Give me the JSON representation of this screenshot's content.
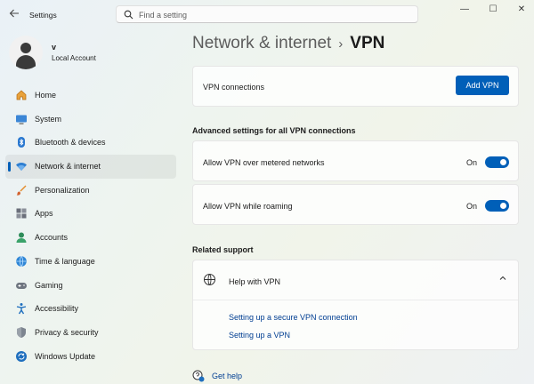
{
  "window": {
    "app_title": "Settings",
    "controls": {
      "minimize": "—",
      "maximize": "☐",
      "close": "✕"
    }
  },
  "search": {
    "placeholder": "Find a setting",
    "value": ""
  },
  "profile": {
    "name": "v",
    "account_type": "Local Account"
  },
  "sidebar": {
    "items": [
      {
        "label": "Home",
        "icon": "home-icon"
      },
      {
        "label": "System",
        "icon": "system-icon"
      },
      {
        "label": "Bluetooth & devices",
        "icon": "bluetooth-icon"
      },
      {
        "label": "Network & internet",
        "icon": "wifi-icon",
        "selected": true
      },
      {
        "label": "Personalization",
        "icon": "brush-icon"
      },
      {
        "label": "Apps",
        "icon": "apps-icon"
      },
      {
        "label": "Accounts",
        "icon": "accounts-icon"
      },
      {
        "label": "Time & language",
        "icon": "globe-icon"
      },
      {
        "label": "Gaming",
        "icon": "gamepad-icon"
      },
      {
        "label": "Accessibility",
        "icon": "accessibility-icon"
      },
      {
        "label": "Privacy & security",
        "icon": "shield-icon"
      },
      {
        "label": "Windows Update",
        "icon": "update-icon"
      }
    ]
  },
  "breadcrumb": {
    "parent": "Network & internet",
    "separator": "›",
    "current": "VPN"
  },
  "vpn_connections": {
    "label": "VPN connections",
    "button": "Add VPN"
  },
  "advanced": {
    "heading": "Advanced settings for all VPN connections",
    "settings": [
      {
        "label": "Allow VPN over metered networks",
        "state": "On",
        "on": true
      },
      {
        "label": "Allow VPN while roaming",
        "state": "On",
        "on": true
      }
    ]
  },
  "related": {
    "heading": "Related support",
    "help_title": "Help with VPN",
    "links": [
      "Setting up a secure VPN connection",
      "Setting up a VPN"
    ]
  },
  "get_help": "Get help",
  "colors": {
    "accent": "#005fb8",
    "link": "#003e92"
  }
}
